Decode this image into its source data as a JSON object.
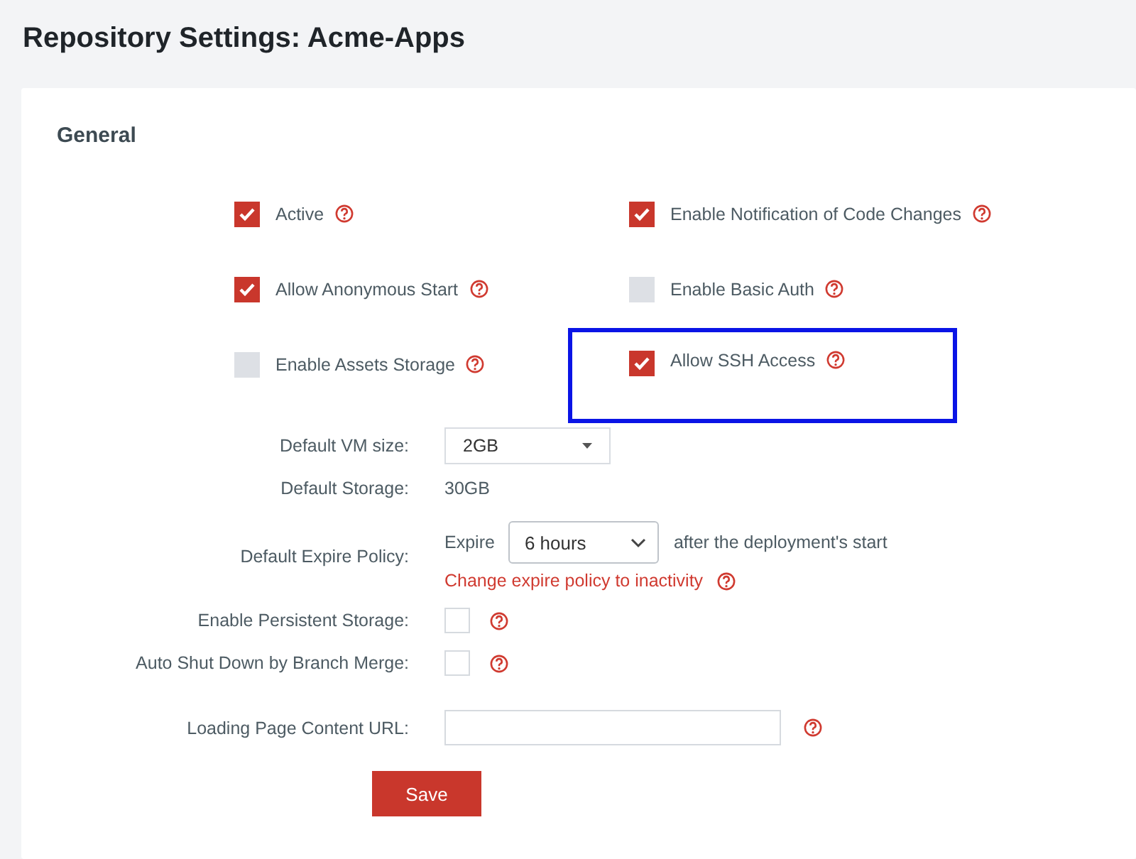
{
  "page": {
    "title": "Repository Settings: Acme-Apps"
  },
  "section": {
    "title": "General"
  },
  "options": [
    {
      "label": "Active",
      "checked": true,
      "highlighted": false
    },
    {
      "label": "Enable Notification of Code Changes",
      "checked": true,
      "highlighted": false
    },
    {
      "label": "Allow Anonymous Start",
      "checked": true,
      "highlighted": false
    },
    {
      "label": "Enable Basic Auth",
      "checked": false,
      "highlighted": false
    },
    {
      "label": "Enable Assets Storage",
      "checked": false,
      "highlighted": false
    },
    {
      "label": "Allow SSH Access",
      "checked": true,
      "highlighted": true
    }
  ],
  "fields": [
    {
      "kind": "select",
      "label": "Default VM size:",
      "value": "2GB"
    },
    {
      "kind": "text",
      "label": "Default Storage:",
      "value": "30GB"
    },
    {
      "kind": "expire",
      "label": "Default Expire Policy:",
      "prefix": "Expire",
      "value": "6 hours",
      "suffix": "after the deployment's start",
      "link": "Change expire policy to inactivity"
    },
    {
      "kind": "checkbox",
      "label": "Enable Persistent Storage:",
      "checked": false
    },
    {
      "kind": "checkbox",
      "label": "Auto Shut Down by Branch Merge:",
      "checked": false
    },
    {
      "kind": "input",
      "label": "Loading Page Content URL:"
    }
  ],
  "save_button": "Save"
}
